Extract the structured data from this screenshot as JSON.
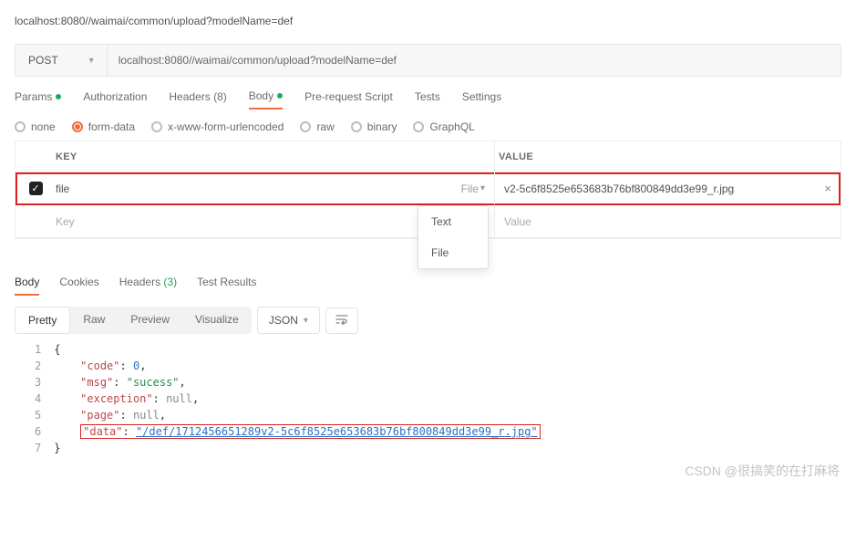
{
  "topAddress": "localhost:8080//waimai/common/upload?modelName=def",
  "method": "POST",
  "url": "localhost:8080//waimai/common/upload?modelName=def",
  "reqTabs": {
    "params": "Params",
    "auth": "Authorization",
    "headers": "Headers (8)",
    "body": "Body",
    "prereq": "Pre-request Script",
    "tests": "Tests",
    "settings": "Settings"
  },
  "bodyTypes": {
    "none": "none",
    "formdata": "form-data",
    "xwww": "x-www-form-urlencoded",
    "raw": "raw",
    "binary": "binary",
    "graphql": "GraphQL"
  },
  "kv": {
    "headKey": "KEY",
    "headValue": "VALUE",
    "row1": {
      "key": "file",
      "type": "File",
      "value": "v2-5c6f8525e653683b76bf800849dd3e99_r.jpg"
    },
    "placeholderKey": "Key",
    "placeholderValue": "Value",
    "dd1": "Text",
    "dd2": "File"
  },
  "respTabs": {
    "body": "Body",
    "cookies": "Cookies",
    "headers": "Headers",
    "headersCount": "(3)",
    "tests": "Test Results"
  },
  "viewSeg": {
    "pretty": "Pretty",
    "raw": "Raw",
    "preview": "Preview",
    "vis": "Visualize"
  },
  "fmt": "JSON",
  "json": {
    "l1": "{",
    "k2": "\"code\"",
    "v2": "0",
    "k3": "\"msg\"",
    "v3": "\"sucess\"",
    "k4": "\"exception\"",
    "v4": "null",
    "k5": "\"page\"",
    "v5": "null",
    "k6": "\"data\"",
    "v6": "\"/def/1712456651289v2-5c6f8525e653683b76bf800849dd3e99_r.jpg\"",
    "l7": "}"
  },
  "watermark": "CSDN @很搞笑的在打麻将",
  "chart_data": {
    "type": "table",
    "title": "Response JSON",
    "rows": [
      {
        "code": 0,
        "msg": "sucess",
        "exception": null,
        "page": null,
        "data": "/def/1712456651289v2-5c6f8525e653683b76bf800849dd3e99_r.jpg"
      }
    ]
  }
}
